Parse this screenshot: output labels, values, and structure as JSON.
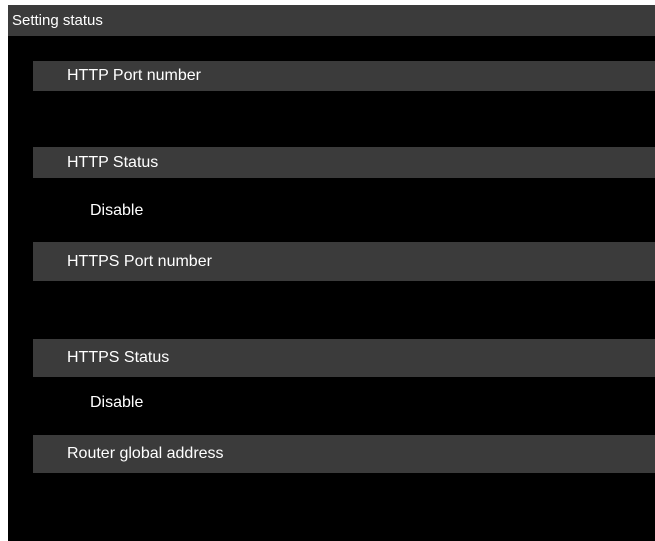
{
  "page": {
    "title": "Setting status"
  },
  "sections": [
    {
      "label": "HTTP Port number",
      "value": ""
    },
    {
      "label": "HTTP Status",
      "value": "Disable"
    },
    {
      "label": "HTTPS Port number",
      "value": ""
    },
    {
      "label": "HTTPS Status",
      "value": "Disable"
    },
    {
      "label": "Router global address",
      "value": ""
    }
  ],
  "colors": {
    "background": "#000000",
    "header_bar": "#3b3b3b",
    "text": "#ffffff"
  }
}
